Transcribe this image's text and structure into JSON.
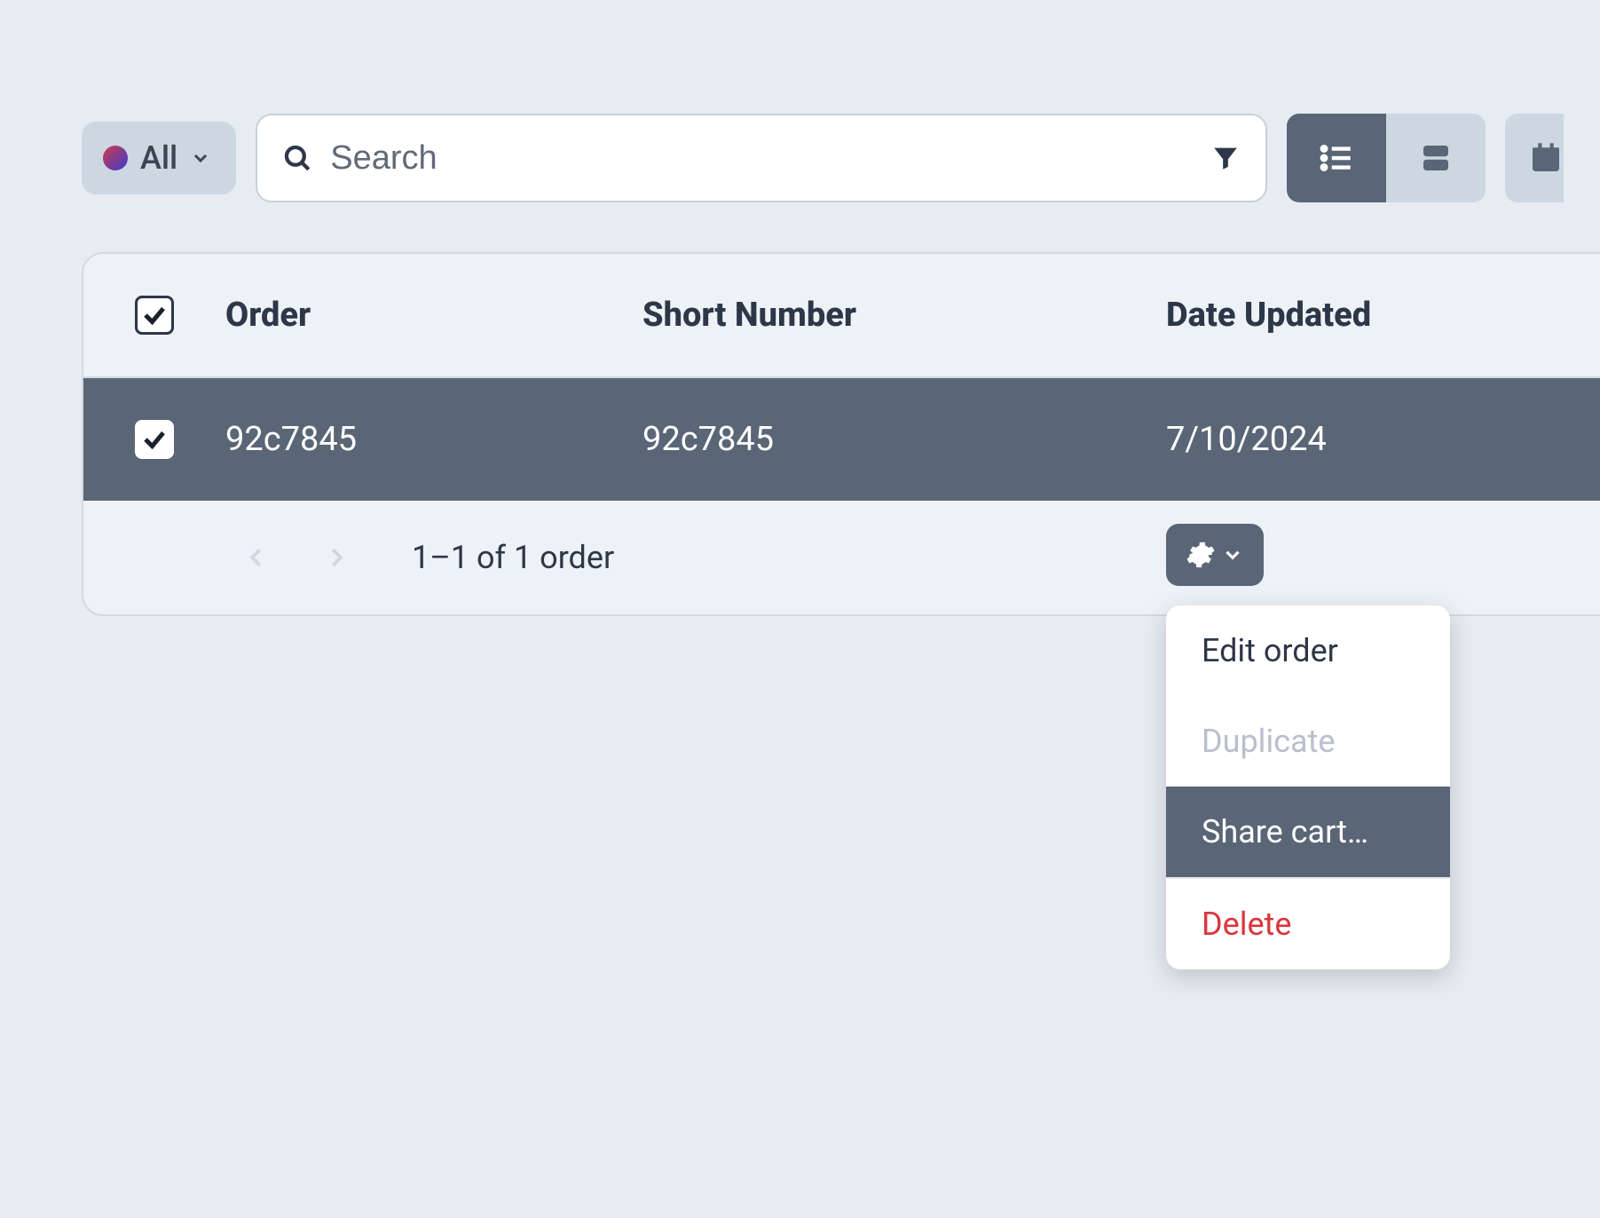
{
  "toolbar": {
    "filter_label": "All",
    "search_placeholder": "Search"
  },
  "table": {
    "columns": {
      "order": "Order",
      "short_number": "Short Number",
      "date_updated": "Date Updated"
    },
    "rows": [
      {
        "order": "92c7845",
        "short_number": "92c7845",
        "date_updated": "7/10/2024"
      }
    ],
    "pager_text": "1–1 of 1 order"
  },
  "menu": {
    "edit": "Edit order",
    "duplicate": "Duplicate",
    "share": "Share cart…",
    "delete": "Delete"
  }
}
